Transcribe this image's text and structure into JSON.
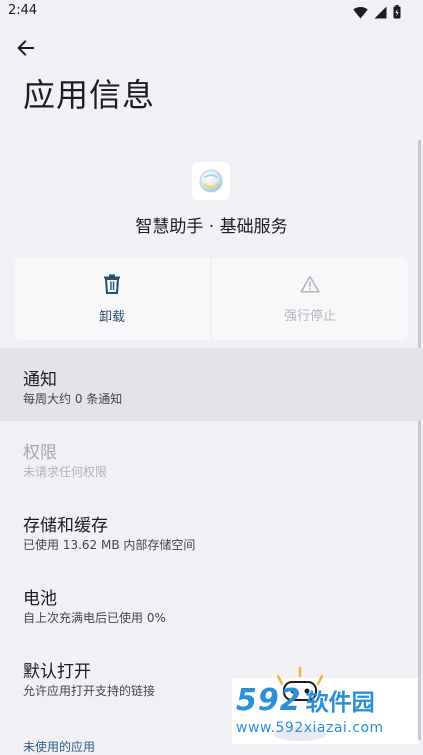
{
  "status_bar": {
    "time": "2:44"
  },
  "header": {
    "title": "应用信息"
  },
  "app": {
    "name": "智慧助手 · 基础服务"
  },
  "actions": {
    "uninstall_label": "卸载",
    "force_stop_label": "强行停止"
  },
  "items": [
    {
      "title": "通知",
      "subtitle": "每周大约 0 条通知"
    },
    {
      "title": "权限",
      "subtitle": "未请求任何权限"
    },
    {
      "title": "存储和缓存",
      "subtitle": "已使用 13.62 MB 内部存储空间"
    },
    {
      "title": "电池",
      "subtitle": "自上次充满电后已使用 0%"
    },
    {
      "title": "默认打开",
      "subtitle": "允许应用打开支持的链接"
    }
  ],
  "section": {
    "unused_apps": "未使用的应用"
  },
  "watermark": {
    "number": "592",
    "name": "软件园",
    "url": "www.592xiazai.com"
  },
  "colors": {
    "accent": "#2b4f6e",
    "background": "#f1f0f5",
    "highlight": "#e4e3e8",
    "watermark": "#2c8fd9"
  }
}
